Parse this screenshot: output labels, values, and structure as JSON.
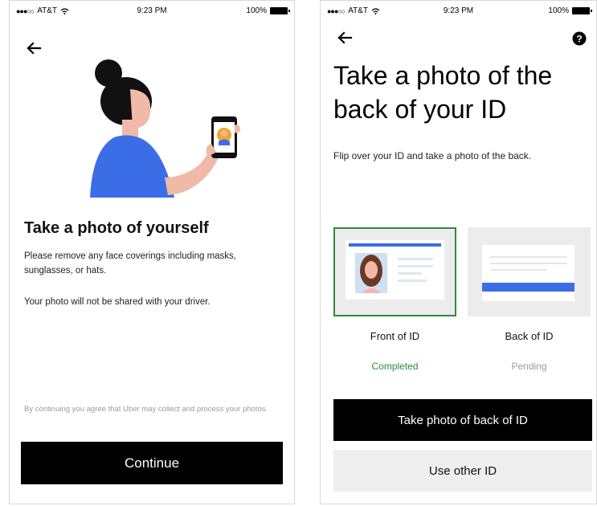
{
  "left_screen": {
    "status_bar": {
      "carrier": "AT&T",
      "time": "9:23 PM",
      "battery": "100%"
    },
    "back_icon": "arrow-left-icon",
    "title": "Take a photo of yourself",
    "body_1": "Please remove any face coverings including masks, sunglasses, or hats.",
    "body_2": "Your photo will not be shared with your driver.",
    "disclaimer": "By continuing you agree that Uber may collect and process your photos.",
    "continue_label": "Continue"
  },
  "right_screen": {
    "status_bar": {
      "carrier": "AT&T",
      "time": "9:23 PM",
      "battery": "100%"
    },
    "back_icon": "arrow-left-icon",
    "help_icon": "question-circle-icon",
    "title": "Take a photo of the back of your ID",
    "body": "Flip over your ID and take a photo of the back.",
    "cards": [
      {
        "label": "Front of ID",
        "status": "Completed",
        "state": "completed"
      },
      {
        "label": "Back of ID",
        "status": "Pending",
        "state": "pending"
      }
    ],
    "primary_button": "Take photo of back of ID",
    "secondary_button": "Use other ID"
  },
  "colors": {
    "primary": "#000000",
    "completed": "#2e8b3a",
    "pending": "#9a9a9a",
    "accent_blue": "#3b6ee6",
    "button_secondary_bg": "#eeeeee"
  }
}
